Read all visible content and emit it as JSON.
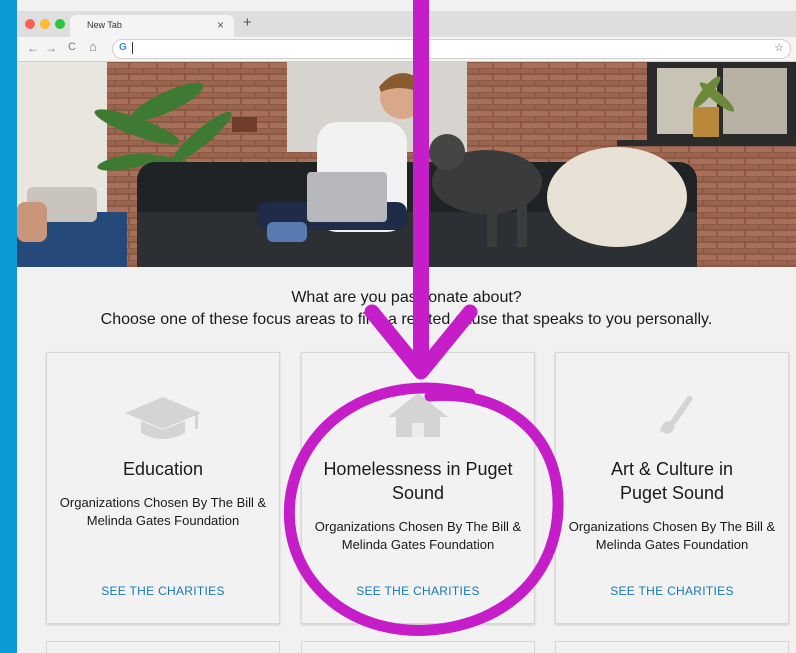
{
  "browser": {
    "tab_title": "New Tab",
    "tab_close": "×",
    "new_tab": "+",
    "nav": {
      "back": "←",
      "forward": "→",
      "reload": "C",
      "home": "⌂"
    },
    "omnibox_g": "G",
    "star": "☆"
  },
  "page": {
    "question_line1": "What are you passionate about?",
    "question_line2": "Choose one of these focus areas to find a related cause that speaks to you personally.",
    "cards": [
      {
        "title": "Education",
        "subtitle": "Organizations Chosen By The Bill & Melinda Gates Foundation",
        "cta": "SEE THE CHARITIES",
        "icon": "graduation-cap-icon"
      },
      {
        "title": "Homelessness in Puget Sound",
        "subtitle": "Organizations Chosen By The Bill & Melinda Gates Foundation",
        "cta": "SEE THE CHARITIES",
        "icon": "house-icon"
      },
      {
        "title": "Art & Culture in Puget Sound",
        "subtitle": "Organizations Chosen By The Bill & Melinda Gates Foundation",
        "cta": "SEE THE CHARITIES",
        "icon": "paintbrush-icon"
      }
    ]
  },
  "colors": {
    "background": "#0a9ad6",
    "link": "#1878b6",
    "annotation": "#c51ec9"
  }
}
